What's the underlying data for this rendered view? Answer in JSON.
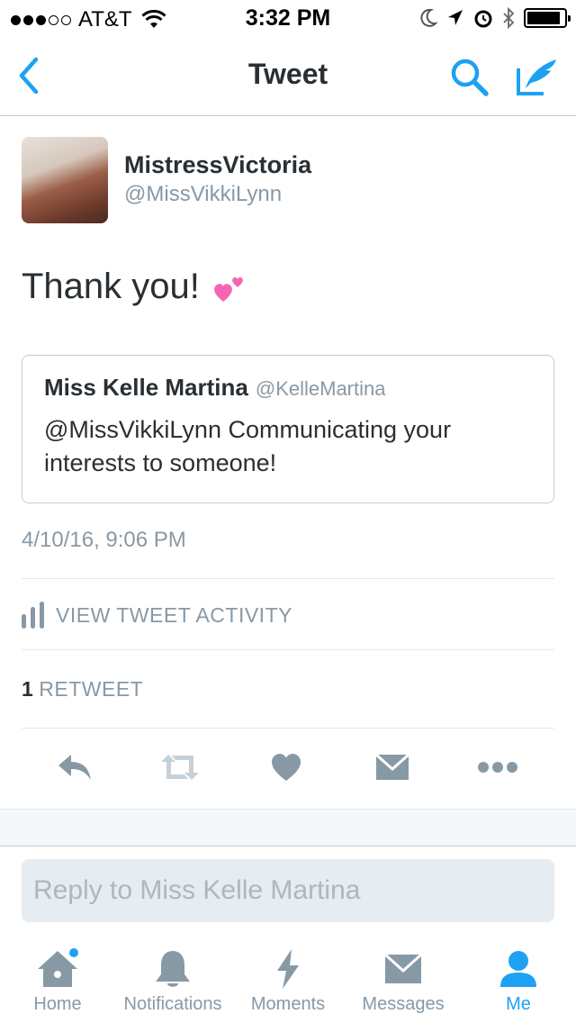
{
  "status_bar": {
    "carrier": "AT&T",
    "time": "3:32 PM",
    "signal_bars_filled": 3,
    "signal_bars_total": 5,
    "battery_level": 0.9,
    "icons": [
      "wifi-icon",
      "moon-icon",
      "location-arrow-icon",
      "alarm-icon",
      "bluetooth-icon",
      "battery-icon"
    ]
  },
  "nav": {
    "title": "Tweet",
    "icons": [
      "back-chevron-icon",
      "search-icon",
      "compose-icon"
    ],
    "accent_color": "#1da1f2"
  },
  "tweet": {
    "display_name": "MistressVictoria",
    "screen_name": "@MissVikkiLynn",
    "text": "Thank you!",
    "emoji": "two-hearts-emoji",
    "timestamp": "4/10/16, 9:06 PM",
    "activity_label": "VIEW TWEET ACTIVITY",
    "retweet_count": "1",
    "retweet_label": "RETWEET"
  },
  "quote": {
    "display_name": "Miss Kelle Martina",
    "screen_name": "@KelleMartina",
    "text": "@MissVikkiLynn Communicating your interests to someone!"
  },
  "actions": [
    "reply-icon",
    "retweet-icon",
    "like-icon",
    "direct-message-icon",
    "more-icon"
  ],
  "reply": {
    "placeholder": "Reply to Miss Kelle Martina"
  },
  "tabs": [
    {
      "label": "Home",
      "icon": "home-icon",
      "badge": true
    },
    {
      "label": "Notifications",
      "icon": "bell-icon"
    },
    {
      "label": "Moments",
      "icon": "lightning-icon"
    },
    {
      "label": "Messages",
      "icon": "envelope-icon"
    },
    {
      "label": "Me",
      "icon": "person-icon",
      "active": true
    }
  ],
  "colors": {
    "text": "#292f33",
    "secondary": "#8899a6",
    "accent": "#1da1f2",
    "divider": "#e1e8ed"
  }
}
